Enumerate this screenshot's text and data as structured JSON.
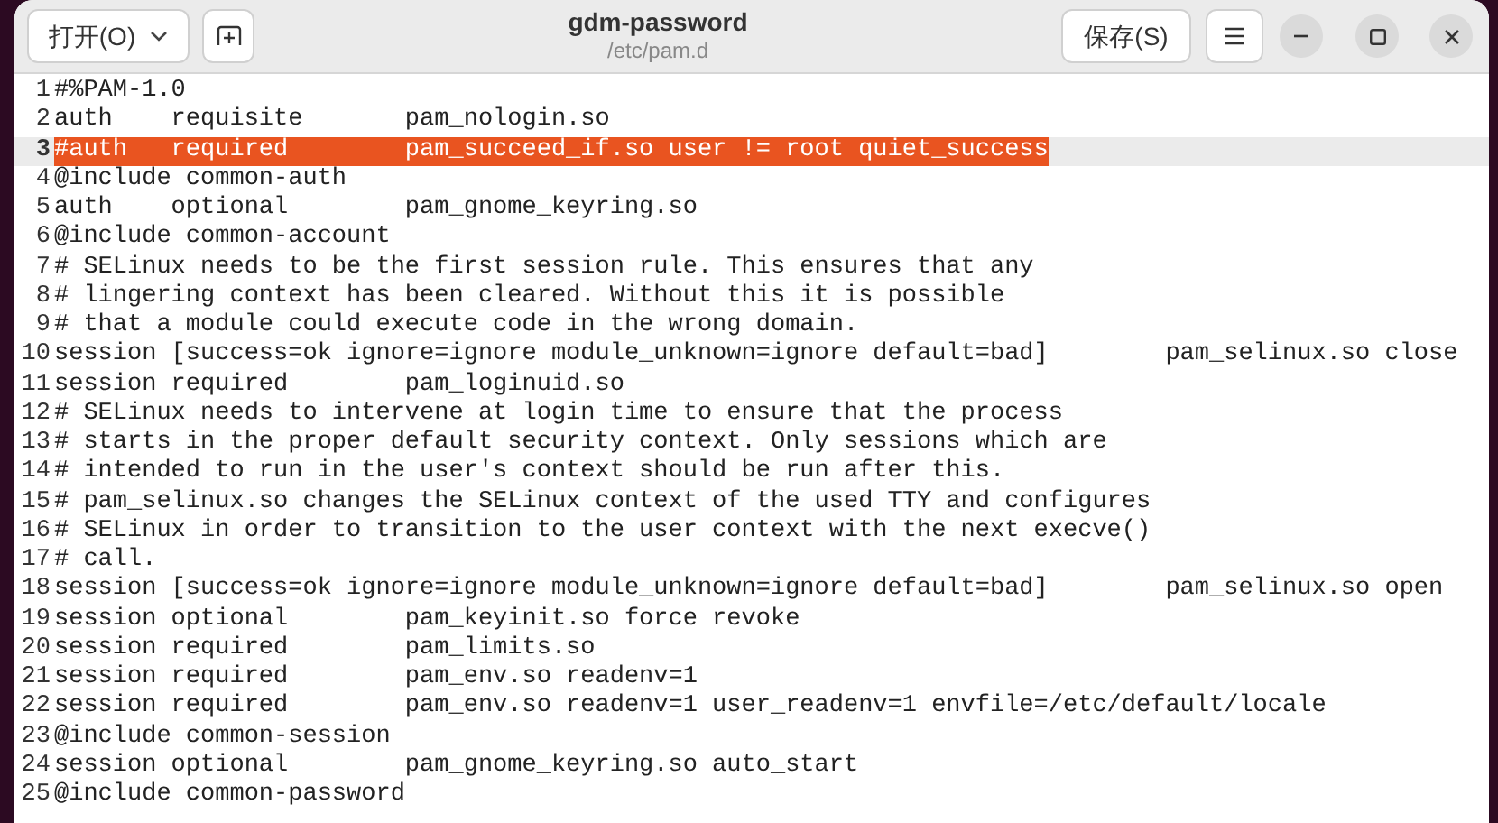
{
  "header": {
    "open_button": "打开(O)",
    "title": "gdm-password",
    "subtitle": "/etc/pam.d",
    "save_button": "保存(S)"
  },
  "editor": {
    "lines": [
      {
        "number": "1",
        "text": "#%PAM-1.0",
        "current": false,
        "selected": false
      },
      {
        "number": "2",
        "text": "auth    requisite       pam_nologin.so",
        "current": false,
        "selected": false
      },
      {
        "number": "3",
        "text": "#auth   required        pam_succeed_if.so user != root quiet_success",
        "current": true,
        "selected": true
      },
      {
        "number": "4",
        "text": "@include common-auth",
        "current": false,
        "selected": false
      },
      {
        "number": "5",
        "text": "auth    optional        pam_gnome_keyring.so",
        "current": false,
        "selected": false
      },
      {
        "number": "6",
        "text": "@include common-account",
        "current": false,
        "selected": false
      },
      {
        "number": "7",
        "text": "# SELinux needs to be the first session rule. This ensures that any",
        "current": false,
        "selected": false
      },
      {
        "number": "8",
        "text": "# lingering context has been cleared. Without this it is possible",
        "current": false,
        "selected": false
      },
      {
        "number": "9",
        "text": "# that a module could execute code in the wrong domain.",
        "current": false,
        "selected": false
      },
      {
        "number": "10",
        "text": "session [success=ok ignore=ignore module_unknown=ignore default=bad]        pam_selinux.so close",
        "current": false,
        "selected": false
      },
      {
        "number": "11",
        "text": "session required        pam_loginuid.so",
        "current": false,
        "selected": false
      },
      {
        "number": "12",
        "text": "# SELinux needs to intervene at login time to ensure that the process",
        "current": false,
        "selected": false
      },
      {
        "number": "13",
        "text": "# starts in the proper default security context. Only sessions which are",
        "current": false,
        "selected": false
      },
      {
        "number": "14",
        "text": "# intended to run in the user's context should be run after this.",
        "current": false,
        "selected": false
      },
      {
        "number": "15",
        "text": "# pam_selinux.so changes the SELinux context of the used TTY and configures",
        "current": false,
        "selected": false
      },
      {
        "number": "16",
        "text": "# SELinux in order to transition to the user context with the next execve()",
        "current": false,
        "selected": false
      },
      {
        "number": "17",
        "text": "# call.",
        "current": false,
        "selected": false
      },
      {
        "number": "18",
        "text": "session [success=ok ignore=ignore module_unknown=ignore default=bad]        pam_selinux.so open",
        "current": false,
        "selected": false
      },
      {
        "number": "19",
        "text": "session optional        pam_keyinit.so force revoke",
        "current": false,
        "selected": false
      },
      {
        "number": "20",
        "text": "session required        pam_limits.so",
        "current": false,
        "selected": false
      },
      {
        "number": "21",
        "text": "session required        pam_env.so readenv=1",
        "current": false,
        "selected": false
      },
      {
        "number": "22",
        "text": "session required        pam_env.so readenv=1 user_readenv=1 envfile=/etc/default/locale",
        "current": false,
        "selected": false
      },
      {
        "number": "23",
        "text": "@include common-session",
        "current": false,
        "selected": false
      },
      {
        "number": "24",
        "text": "session optional        pam_gnome_keyring.so auto_start",
        "current": false,
        "selected": false
      },
      {
        "number": "25",
        "text": "@include common-password",
        "current": false,
        "selected": false
      }
    ]
  }
}
